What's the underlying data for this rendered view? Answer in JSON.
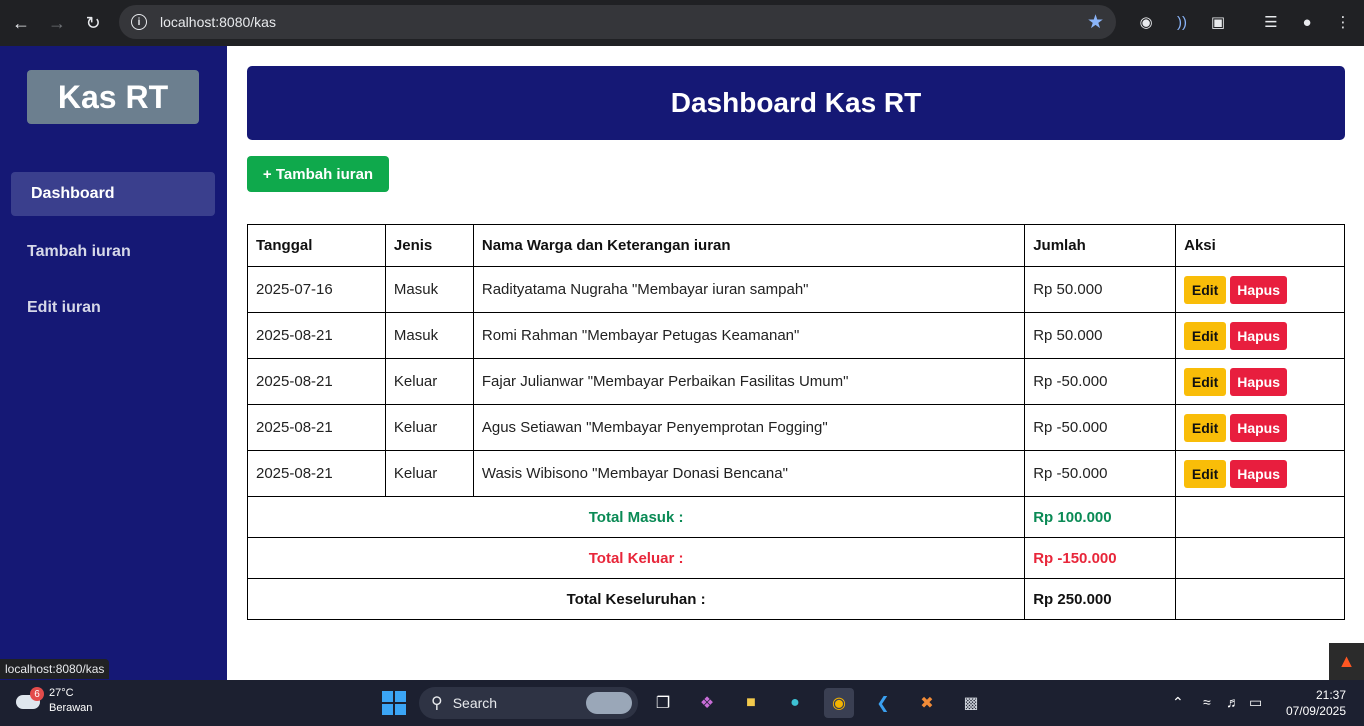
{
  "browser": {
    "url": "localhost:8080/kas",
    "status_url": "localhost:8080/kas"
  },
  "sidebar": {
    "brand": "Kas RT",
    "items": [
      {
        "label": "Dashboard",
        "active": true
      },
      {
        "label": "Tambah iuran",
        "active": false
      },
      {
        "label": "Edit iuran",
        "active": false
      }
    ]
  },
  "main": {
    "title": "Dashboard Kas RT",
    "add_button": "+ Tambah iuran",
    "table": {
      "headers": [
        "Tanggal",
        "Jenis",
        "Nama Warga dan Keterangan iuran",
        "Jumlah",
        "Aksi"
      ],
      "rows": [
        {
          "tanggal": "2025-07-16",
          "jenis": "Masuk",
          "keterangan": "Radityatama Nugraha \"Membayar iuran sampah\"",
          "jumlah": "Rp 50.000"
        },
        {
          "tanggal": "2025-08-21",
          "jenis": "Masuk",
          "keterangan": "Romi Rahman \"Membayar Petugas Keamanan\"",
          "jumlah": "Rp 50.000"
        },
        {
          "tanggal": "2025-08-21",
          "jenis": "Keluar",
          "keterangan": "Fajar Julianwar \"Membayar Perbaikan Fasilitas Umum\"",
          "jumlah": "Rp -50.000"
        },
        {
          "tanggal": "2025-08-21",
          "jenis": "Keluar",
          "keterangan": "Agus Setiawan \"Membayar Penyemprotan Fogging\"",
          "jumlah": "Rp -50.000"
        },
        {
          "tanggal": "2025-08-21",
          "jenis": "Keluar",
          "keterangan": "Wasis Wibisono \"Membayar Donasi Bencana\"",
          "jumlah": "Rp -50.000"
        }
      ],
      "edit_label": "Edit",
      "delete_label": "Hapus",
      "totals": {
        "masuk_label": "Total Masuk :",
        "masuk_value": "Rp 100.000",
        "keluar_label": "Total Keluar :",
        "keluar_value": "Rp -150.000",
        "keseluruhan_label": "Total Keseluruhan :",
        "keseluruhan_value": "Rp 250.000"
      }
    }
  },
  "taskbar": {
    "weather_temp": "27°C",
    "weather_desc": "Berawan",
    "weather_badge": "6",
    "search_label": "Search",
    "time": "21:37",
    "date": "07/09/2025"
  },
  "colors": {
    "sidebar_bg": "#151875",
    "header_bg": "#151875",
    "add_button": "#0fa94c",
    "edit_button": "#f9bd08",
    "delete_button": "#e81e3e",
    "total_masuk": "#0a8a55",
    "total_keluar": "#e8263a"
  }
}
